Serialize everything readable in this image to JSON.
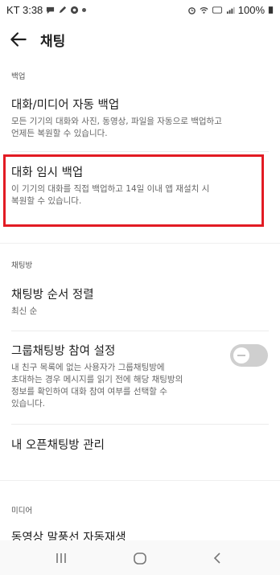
{
  "status_bar": {
    "carrier_time": "KT 3:38",
    "battery": "100%",
    "left_icons": [
      "chat-bubble-icon",
      "edit-icon",
      "recording-icon",
      "dot-icon"
    ],
    "right_icons": [
      "alarm-icon",
      "wifi-icon",
      "hd-icon",
      "signal-icon",
      "battery-icon"
    ]
  },
  "app_bar": {
    "title": "채팅"
  },
  "sections": {
    "backup": {
      "header": "백업",
      "auto_backup": {
        "title": "대화/미디어 자동 백업",
        "desc_line1": "모든 기기의 대화와 사진, 동영상, 파일을 자동으로 백업하고",
        "desc_line2": "언제든 복원할 수 있습니다."
      },
      "temp_backup": {
        "title": "대화 임시 백업",
        "desc_line1": "이 기기의 대화를 직접 백업하고 14일 이내 앱 재설치 시",
        "desc_line2": "복원할 수 있습니다."
      }
    },
    "chatroom": {
      "header": "채팅방",
      "sort_order": {
        "title": "채팅방 순서 정렬",
        "value": "최신 순"
      },
      "group_join": {
        "title": "그룹채팅방 참여 설정",
        "desc_line1": "내 친구 목록에 없는 사용자가 그룹채팅방에",
        "desc_line2": "초대하는 경우 메시지를 읽기 전에 해당 채팅방의",
        "desc_line3": "정보를 확인하여 대화 참여 여부를 선택할 수",
        "desc_line4": "있습니다.",
        "toggle_on": false
      },
      "open_chat": {
        "title": "내 오픈채팅방 관리"
      }
    },
    "media": {
      "header": "미디어",
      "autoplay": {
        "title": "동영상 말풍선 자동재생"
      }
    }
  },
  "nav_bar": {
    "buttons": [
      "recent-apps-icon",
      "home-icon",
      "back-icon"
    ]
  },
  "colors": {
    "highlight": "#e21b23",
    "toggle_off": "#cfcfcf",
    "text_primary": "#1e1e1e",
    "text_secondary": "#666666"
  }
}
